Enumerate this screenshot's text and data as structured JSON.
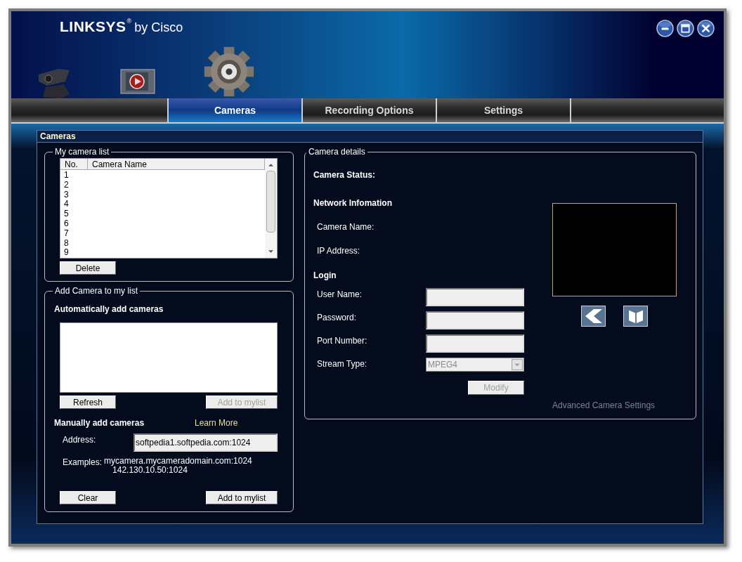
{
  "header": {
    "brand": "LINKSYS",
    "brand_mark": "®",
    "brand_suffix": "by Cisco"
  },
  "window_buttons": [
    {
      "kind": "minimize"
    },
    {
      "kind": "maximize"
    },
    {
      "kind": "close"
    }
  ],
  "tabs": [
    {
      "label": "Cameras",
      "selected": true
    },
    {
      "label": "Recording Options",
      "selected": false
    },
    {
      "label": "Settings",
      "selected": false
    }
  ],
  "panel": {
    "title": "Cameras"
  },
  "camera_list": {
    "legend": "My camera list",
    "columns": [
      "No.",
      "Camera Name"
    ],
    "rows": [
      "1",
      "2",
      "3",
      "4",
      "5",
      "6",
      "7",
      "8",
      "9"
    ],
    "delete_button": {
      "label": "Delete",
      "disabled": false
    }
  },
  "add_camera": {
    "legend": "Add Camera to my list",
    "auto_heading": "Automatically add cameras",
    "refresh_button": {
      "label": "Refresh",
      "disabled": false
    },
    "auto_add_button": {
      "label": "Add to mylist",
      "disabled": true
    },
    "manual_heading": "Manually add cameras",
    "learn_more": "Learn More",
    "address_label": "Address:",
    "address_value": "softpedia1.softpedia.com:1024",
    "examples_label": "Examples:",
    "examples": [
      "mycamera.mycameradomain.com:1024",
      "142.130.10.50:1024"
    ],
    "clear_button": {
      "label": "Clear",
      "disabled": false
    },
    "manual_add_button": {
      "label": "Add to mylist",
      "disabled": false
    }
  },
  "details": {
    "legend": "Camera details",
    "status_heading": "Camera Status:",
    "network_heading": "Network Infomation",
    "network_fields": [
      "Camera Name:",
      "IP Address:"
    ],
    "login_heading": "Login",
    "login_fields": [
      {
        "label": "User Name:",
        "kind": "text"
      },
      {
        "label": "Password:",
        "kind": "text"
      },
      {
        "label": "Port Number:",
        "kind": "text"
      },
      {
        "label": "Stream Type:",
        "kind": "select",
        "value": "MPEG4",
        "disabled": true
      }
    ],
    "modify_button": {
      "label": "Modify",
      "disabled": true
    },
    "advanced_link": {
      "label": "Advanced Camera Settings",
      "disabled": true
    }
  }
}
